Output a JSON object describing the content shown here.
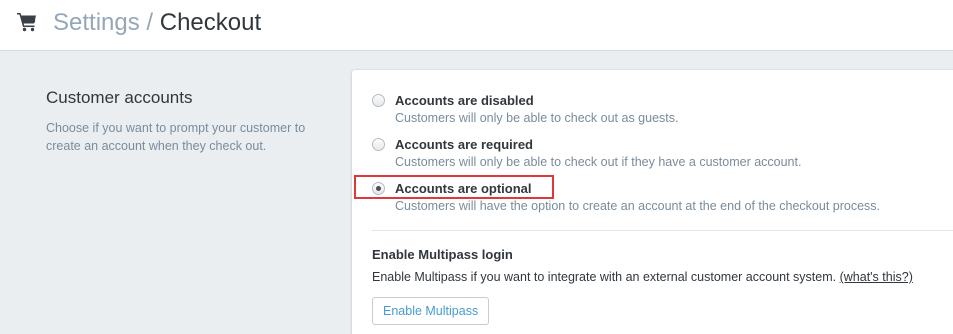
{
  "header": {
    "cart_icon": "shopping-cart-icon",
    "breadcrumb_parent": "Settings",
    "breadcrumb_separator": "/",
    "page_title": "Checkout"
  },
  "customer_accounts": {
    "title": "Customer accounts",
    "description": "Choose if you want to prompt your customer to create an account when they check out.",
    "options": [
      {
        "label": "Accounts are disabled",
        "help": "Customers will only be able to check out as guests.",
        "selected": false
      },
      {
        "label": "Accounts are required",
        "help": "Customers will only be able to check out if they have a customer account.",
        "selected": false
      },
      {
        "label": "Accounts are optional",
        "help": "Customers will have the option to create an account at the end of the checkout process.",
        "selected": true
      }
    ],
    "highlight_color": "#e0383a"
  },
  "multipass": {
    "title": "Enable Multipass login",
    "description": "Enable Multipass if you want to integrate with an external customer account system.",
    "link_text": "(what's this?)",
    "button_label": "Enable Multipass"
  }
}
